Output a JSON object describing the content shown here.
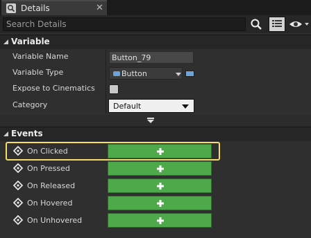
{
  "tab": {
    "title": "Details",
    "icon": "details-magnifier-icon",
    "close_glyph": "✕"
  },
  "search": {
    "placeholder": "Search Details",
    "value": ""
  },
  "variable_section": {
    "title": "Variable",
    "rows": {
      "name": {
        "label": "Variable Name",
        "value": "Button_79"
      },
      "type": {
        "label": "Variable Type",
        "value": "Button"
      },
      "expose": {
        "label": "Expose to Cinematics",
        "checked": false
      },
      "category": {
        "label": "Category",
        "value": "Default"
      }
    }
  },
  "events_section": {
    "title": "Events",
    "items": [
      {
        "label": "On Clicked",
        "highlighted": true
      },
      {
        "label": "On Pressed"
      },
      {
        "label": "On Released"
      },
      {
        "label": "On Hovered"
      },
      {
        "label": "On Unhovered"
      }
    ],
    "add_glyph": "+"
  },
  "colors": {
    "add_button_green": "#4ea94a",
    "highlight_yellow": "#f5dd68",
    "object_type_blue": "#6fa3d6",
    "panel_bg": "#2f2f2f"
  }
}
